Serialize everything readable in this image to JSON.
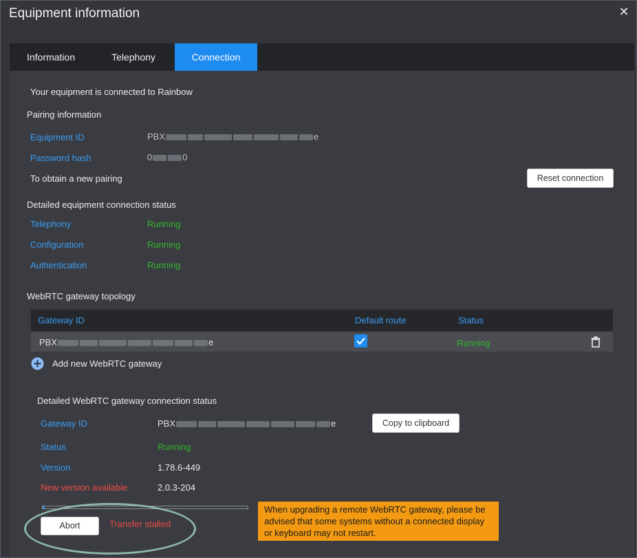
{
  "window": {
    "title": "Equipment information"
  },
  "tabs": [
    {
      "label": "Information"
    },
    {
      "label": "Telephony"
    },
    {
      "label": "Connection"
    }
  ],
  "connection": {
    "connected_message": "Your equipment is connected to Rainbow",
    "pairing": {
      "heading": "Pairing information",
      "equipment_id_label": "Equipment ID",
      "equipment_id_prefix": "PBX",
      "equipment_id_suffix": "e",
      "password_hash_label": "Password hash",
      "password_hash_prefix": "0",
      "password_hash_suffix": "0",
      "new_pairing_label": "To obtain a new pairing",
      "reset_button": "Reset connection"
    },
    "status": {
      "heading": "Detailed equipment connection status",
      "items": [
        {
          "label": "Telephony",
          "value": "Running"
        },
        {
          "label": "Configuration",
          "value": "Running"
        },
        {
          "label": "Authentication",
          "value": "Running"
        }
      ]
    },
    "topology": {
      "heading": "WebRTC gateway topology",
      "columns": [
        "Gateway ID",
        "Default route",
        "Status"
      ],
      "rows": [
        {
          "gateway_prefix": "PBX",
          "gateway_suffix": "e",
          "default_route": true,
          "status": "Running"
        }
      ],
      "add_label": "Add new WebRTC gateway"
    },
    "gateway_status": {
      "heading": "Detailed WebRTC gateway connection status",
      "gateway_id_label": "Gateway ID",
      "gateway_id_prefix": "PBX",
      "gateway_id_suffix": "e",
      "copy_button": "Copy to clipboard",
      "status_label": "Status",
      "status_value": "Running",
      "version_label": "Version",
      "version_value": "1.78.6-449",
      "new_version_label": "New version available",
      "new_version_value": "2.0.3-204",
      "progress_fraction": 0.01,
      "abort_button": "Abort",
      "transfer_status": "Transfer stalled",
      "upgrade_note": "When upgrading a remote WebRTC gateway, please be advised that some systems without a connected display or keyboard may not restart."
    }
  },
  "colors": {
    "accent": "#1d8bf0",
    "label_blue": "#3a9cf4",
    "running_green": "#34b52f",
    "alert_red": "#f04a4a",
    "note_orange": "#f39a12"
  },
  "icons": {
    "close": "close-icon",
    "add": "plus-circle-icon",
    "delete": "trash-icon",
    "check": "checkmark-icon"
  }
}
